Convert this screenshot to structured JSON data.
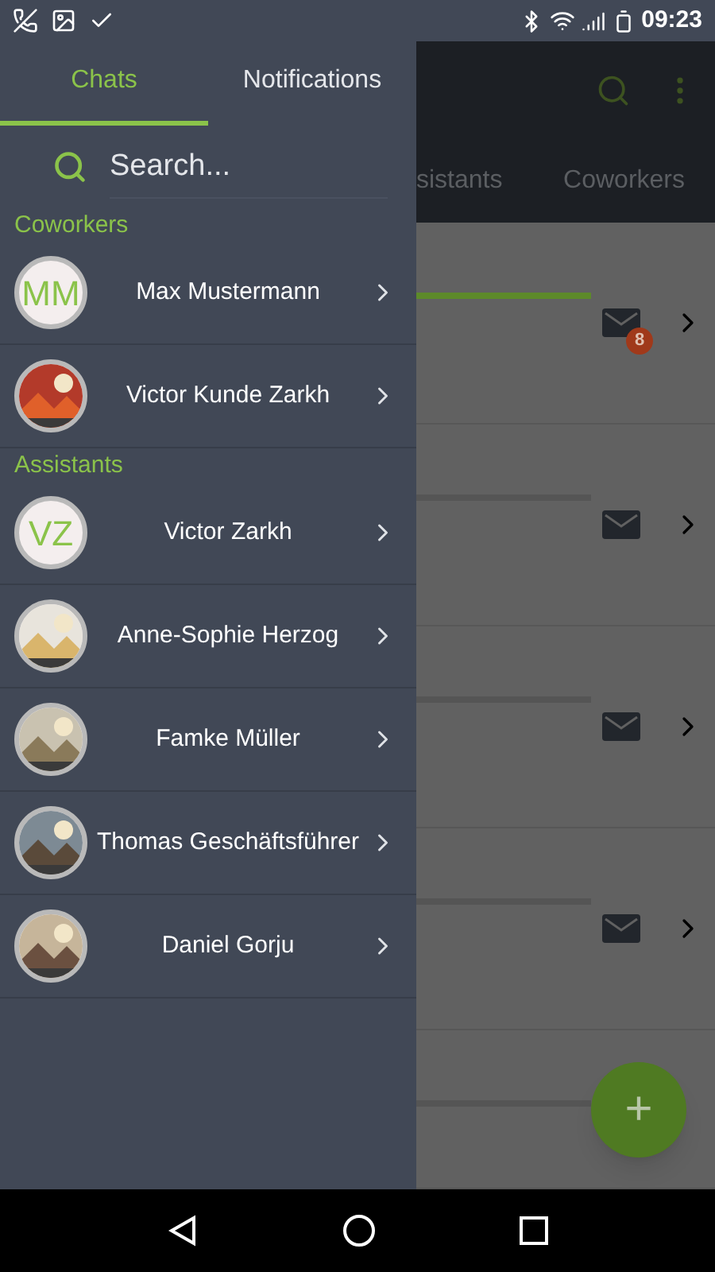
{
  "status_bar": {
    "time": "09:23"
  },
  "background": {
    "tabs": [
      {
        "label": "sistants",
        "selected": false
      },
      {
        "label": "Coworkers",
        "selected": false
      }
    ],
    "rows": [
      {
        "kind": "mail",
        "active": true,
        "badge": "8"
      },
      {
        "kind": "mail",
        "active": false
      },
      {
        "kind": "mail",
        "active": false
      },
      {
        "kind": "mail",
        "active": false
      },
      {
        "kind": "plain",
        "active": false
      }
    ],
    "fab": "+"
  },
  "drawer": {
    "tabs": [
      {
        "label": "Chats",
        "selected": true
      },
      {
        "label": "Notifications",
        "selected": false
      }
    ],
    "search": {
      "placeholder": "Search..."
    },
    "sections": [
      {
        "title": "Coworkers",
        "contacts": [
          {
            "name": "Max Mustermann",
            "avatar": {
              "kind": "initials",
              "text": "MM"
            }
          },
          {
            "name": "Victor Kunde Zarkh"
          }
        ]
      },
      {
        "title": "Assistants",
        "contacts": [
          {
            "name": "Victor Zarkh",
            "avatar": {
              "kind": "initials",
              "text": "VZ"
            }
          },
          {
            "name": "Anne-Sophie Herzog"
          },
          {
            "name": "Famke Müller"
          },
          {
            "name": "Thomas Geschäftsführer"
          },
          {
            "name": "Daniel Gorju"
          }
        ]
      }
    ]
  }
}
